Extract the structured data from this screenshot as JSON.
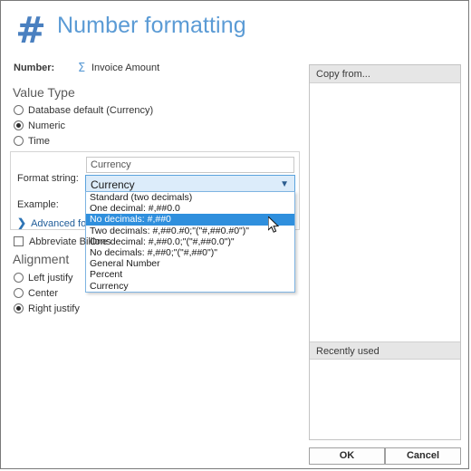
{
  "header": {
    "icon": "hash-icon",
    "title": "Number formatting"
  },
  "number_row": {
    "label": "Number:",
    "icon": "sigma-icon",
    "value": "Invoice Amount"
  },
  "value_type": {
    "title": "Value Type",
    "options": [
      {
        "label": "Database default (Currency)",
        "selected": false
      },
      {
        "label": "Numeric",
        "selected": true
      },
      {
        "label": "Time",
        "selected": false
      }
    ]
  },
  "format_group": {
    "format_label": "Format string:",
    "example_label": "Example:",
    "advanced_link": "Advanced formatting",
    "advanced_chevron": "chevron-right-icon",
    "input_value": "Currency",
    "combo_value": "Currency",
    "combo_arrow": "chevron-down-icon",
    "options": [
      "Standard (two decimals)",
      "One decimal: #,##0.0",
      "No decimals: #,##0",
      "Two decimals: #,##0.#0;\"(\"#,##0.#0\")\"",
      "One decimal: #,##0.0;\"(\"#,##0.0\")\"",
      "No decimals: #,##0;\"(\"#,##0\")\"",
      "General Number",
      "Percent",
      "Currency"
    ],
    "highlighted_index": 2
  },
  "abbreviate": {
    "label": "Abbreviate Billions",
    "checked": false
  },
  "alignment": {
    "title": "Alignment",
    "options": [
      {
        "label": "Left justify",
        "selected": false
      },
      {
        "label": "Center",
        "selected": false
      },
      {
        "label": "Right justify",
        "selected": true
      }
    ]
  },
  "right_pane": {
    "copy_from": "Copy from...",
    "recently_used": "Recently used"
  },
  "buttons": {
    "ok": "OK",
    "cancel": "Cancel"
  },
  "colors": {
    "accent": "#5b9bd5",
    "highlight": "#2f8fdd",
    "combo_bg": "#dcecfa",
    "pane_hdr": "#e6e6e6"
  }
}
